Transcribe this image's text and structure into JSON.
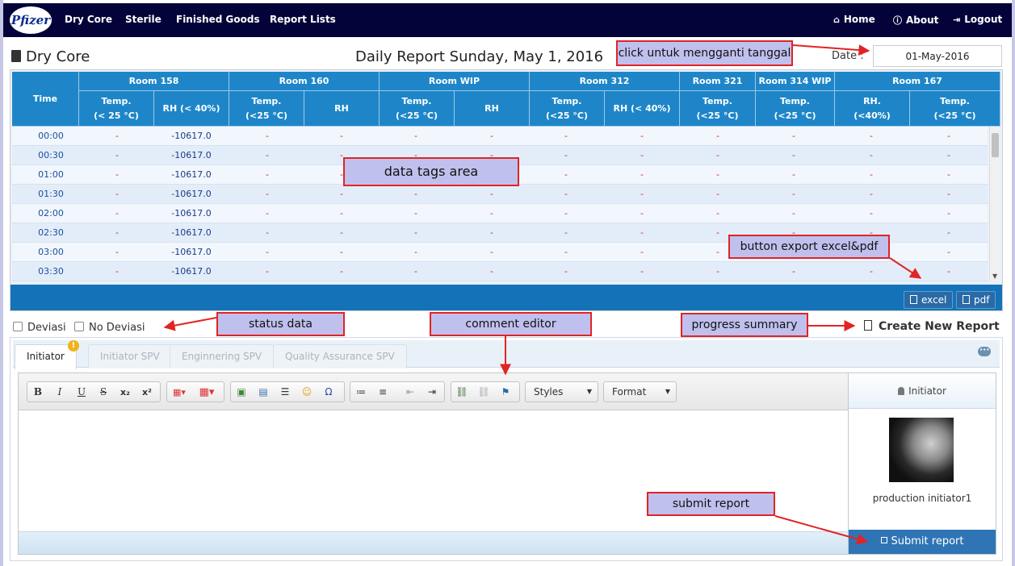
{
  "nav": {
    "logo": "Pfizer",
    "links": [
      "Dry Core",
      "Sterile",
      "Finished Goods",
      "Report Lists"
    ],
    "right": [
      {
        "label": "Home",
        "icon": "home-icon"
      },
      {
        "label": "About",
        "icon": "info-icon"
      },
      {
        "label": "Logout",
        "icon": "logout-icon"
      }
    ]
  },
  "header": {
    "page_title": "Dry Core",
    "report_title": "Daily Report Sunday, May 1, 2016",
    "date_label": "Date :",
    "date_value": "01-May-2016"
  },
  "table": {
    "time_header": "Time",
    "rooms": [
      "Room 158",
      "Room 160",
      "Room WIP",
      "Room 312",
      "Room 321",
      "Room 314 WIP",
      "Room 167"
    ],
    "subheaders": [
      "Temp.\n(< 25 °C)",
      "RH (< 40%)",
      "Temp.\n(<25 °C)",
      "RH",
      "Temp.\n(<25 °C)",
      "RH",
      "Temp.\n(<25 °C)",
      "RH (< 40%)",
      "Temp.\n(<25 °C)",
      "Temp.\n(<25 °C)",
      "RH.\n(<40%)",
      "Temp.\n(<25 °C)"
    ],
    "times": [
      "00:00",
      "00:30",
      "01:00",
      "01:30",
      "02:00",
      "02:30",
      "03:00",
      "03:30"
    ],
    "empty_cell": "-",
    "rh_value": "-10617.0"
  },
  "export": {
    "excel": "excel",
    "pdf": "pdf"
  },
  "status": {
    "deviasi": "Deviasi",
    "no_deviasi": "No Deviasi"
  },
  "create_report": "Create New Report",
  "tabs": [
    "Initiator",
    "Initiator SPV",
    "Enginnering SPV",
    "Quality Assurance SPV"
  ],
  "editor": {
    "styles": "Styles",
    "format": "Format"
  },
  "side": {
    "header": "Initiator",
    "user_name": "production initiator1",
    "submit": "Submit report"
  },
  "annotations": {
    "date": "click untuk mengganti tanggal",
    "data_tags": "data tags area",
    "export": "button export excel&pdf",
    "status": "status data",
    "comment": "comment editor",
    "progress": "progress summary",
    "submit": "submit report"
  },
  "colors": {
    "nav": "#03033a",
    "table_header": "#1e86c8",
    "footbar": "#1473b8",
    "submit": "#2f75b5",
    "note_bg": "#c0c0ee",
    "note_border": "#e12424"
  }
}
